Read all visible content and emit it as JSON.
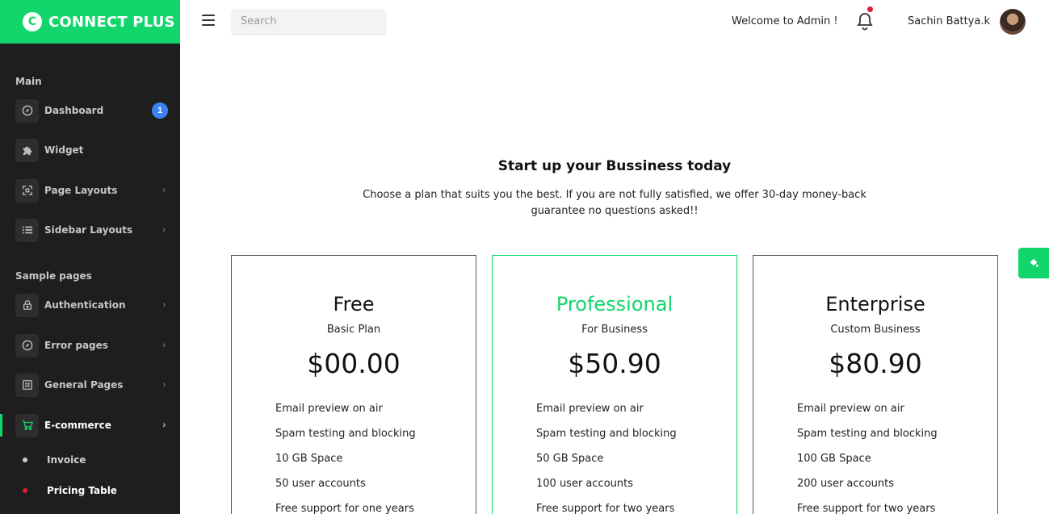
{
  "brand": {
    "logo_letter": "C",
    "name": "CONNECT PLUS",
    "color": "#12d66c"
  },
  "sidebar": {
    "sections": [
      {
        "title": "Main"
      },
      {
        "title": "Sample pages"
      }
    ],
    "items": [
      {
        "label": "Dashboard",
        "icon": "compass-icon",
        "badge": "1"
      },
      {
        "label": "Widget",
        "icon": "puzzle-icon"
      },
      {
        "label": "Page Layouts",
        "icon": "expand-icon",
        "chevron": "›"
      },
      {
        "label": "Sidebar Layouts",
        "icon": "list-icon",
        "chevron": "›"
      },
      {
        "label": "Authentication",
        "icon": "lock-icon",
        "chevron": "›"
      },
      {
        "label": "Error pages",
        "icon": "compass-icon",
        "chevron": "›"
      },
      {
        "label": "General Pages",
        "icon": "grid-icon",
        "chevron": "›"
      },
      {
        "label": "E-commerce",
        "icon": "cart-icon",
        "chevron": "›",
        "active": true
      }
    ],
    "sub_items": [
      {
        "label": "Invoice",
        "dot_color": "#cfcfcf",
        "text_color": "#cfcfcf"
      },
      {
        "label": "Pricing Table",
        "dot_color": "#e11d2e",
        "text_color": "#ffffff",
        "active": true
      }
    ]
  },
  "header": {
    "search_placeholder": "Search",
    "welcome": "Welcome to Admin !",
    "username": "Sachin Battya.k",
    "notification_dot_color": "#e11d2e"
  },
  "main": {
    "headline": "Start up your Bussiness today",
    "subline": "Choose a plan that suits you the best. If you are not fully satisfied, we offer 30-day money-back guarantee no questions asked!!",
    "plans": [
      {
        "name": "Free",
        "subtitle": "Basic Plan",
        "price": "$00.00",
        "features": [
          "Email preview on air",
          "Spam testing and blocking",
          "10 GB Space",
          "50 user accounts",
          "Free support for one years"
        ]
      },
      {
        "name": "Professional",
        "subtitle": "For Business",
        "price": "$50.90",
        "featured": true,
        "features": [
          "Email preview on air",
          "Spam testing and blocking",
          "50 GB Space",
          "100 user accounts",
          "Free support for two years"
        ]
      },
      {
        "name": "Enterprise",
        "subtitle": "Custom Business",
        "price": "$80.90",
        "features": [
          "Email preview on air",
          "Spam testing and blocking",
          "100 GB Space",
          "200 user accounts",
          "Free support for two years"
        ]
      }
    ]
  },
  "floating_button": {
    "icon": "paint-bucket-icon"
  }
}
